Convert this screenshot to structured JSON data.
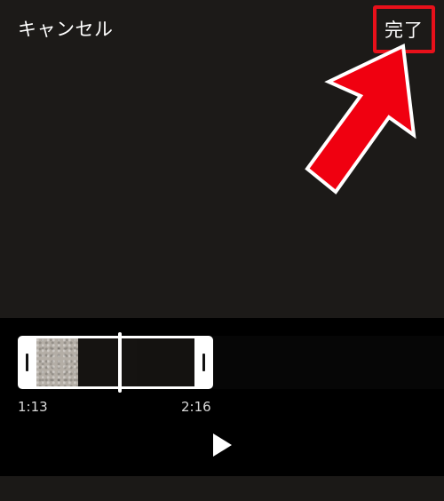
{
  "header": {
    "cancel_label": "キャンセル",
    "done_label": "完了"
  },
  "trimmer": {
    "start_time": "1:13",
    "end_time": "2:16"
  },
  "controls": {
    "play_icon": "play-icon"
  },
  "colors": {
    "highlight_red": "#e8101a",
    "background": "#1a1816",
    "panel": "#000000"
  }
}
